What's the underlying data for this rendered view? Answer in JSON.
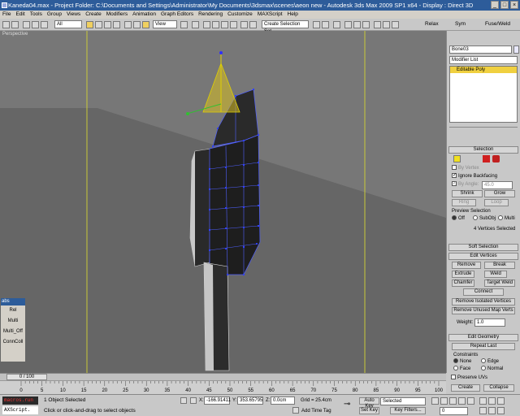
{
  "window": {
    "title": "Kaneda04.max   - Project Folder: C:\\Documents and Settings\\Administrator\\My Documents\\3dsmax\\scenes\\aeon new    - Autodesk 3ds Max  2009 SP1  x64     - Display : Direct 3D",
    "minimize": "_",
    "maximize": "□",
    "close": "×"
  },
  "menu": [
    "File",
    "Edit",
    "Tools",
    "Group",
    "Views",
    "Create",
    "Modifiers",
    "Animation",
    "Graph Editors",
    "Rendering",
    "Customize",
    "MAXScript",
    "Help"
  ],
  "toolbar": {
    "filter": "All",
    "coord": "View",
    "selection_set": "Create Selection Set",
    "relax": "Relax",
    "sym": "Sym",
    "fuse": "Fuse/Weld"
  },
  "viewport": {
    "label": "Perspective"
  },
  "command_panel": {
    "object_name": "Bone03",
    "modifier_list": "Modifier List",
    "stack_item": "Editable Poly",
    "selection": {
      "header": "Selection",
      "by_vertex": "By Vertex",
      "ignore_backfacing": "Ignore Backfacing",
      "by_angle": "By Angle:",
      "angle_value": "45.0",
      "shrink": "Shrink",
      "grow": "Grow",
      "ring": "Ring",
      "loop": "Loop",
      "preview_selection": "Preview Selection",
      "off": "Off",
      "subobj": "SubObj",
      "multi": "Multi",
      "status": "4 Vertices Selected"
    },
    "soft_selection": "Soft Selection",
    "edit_vertices": {
      "header": "Edit Vertices",
      "remove": "Remove",
      "break": "Break",
      "extrude": "Extrude",
      "weld": "Weld",
      "chamfer": "Chamfer",
      "target_weld": "Target Weld",
      "connect": "Connect",
      "remove_isolated": "Remove Isolated Vertices",
      "remove_unused": "Remove Unused Map Verts",
      "weight_label": "Weight:",
      "weight_value": "1.0"
    },
    "edit_geometry": {
      "header": "Edit Geometry",
      "repeat_last": "Repeat Last",
      "constraints": "Constraints",
      "none": "None",
      "edge": "Edge",
      "face": "Face",
      "normal": "Normal",
      "preserve_uvs": "Preserve UVs",
      "create": "Create",
      "collapse": "Collapse"
    }
  },
  "float_panel": {
    "title": "abs",
    "items": [
      "Rel",
      "Multi",
      "Multi_Off",
      "ConnColl"
    ]
  },
  "timeline": {
    "frame": "0 / 100",
    "ticks": [
      "0",
      "5",
      "10",
      "15",
      "20",
      "25",
      "30",
      "35",
      "40",
      "45",
      "50",
      "55",
      "60",
      "65",
      "70",
      "75",
      "80",
      "85",
      "90",
      "95",
      "100"
    ]
  },
  "status": {
    "macro1": "macros.run",
    "macro2": "AXScript.",
    "selected": "1 Object Selected",
    "prompt": "Click or click-and-drag to select objects",
    "x_label": "X:",
    "x_value": "-166.91411",
    "y_label": "Y:",
    "y_value": "353.65795",
    "z_label": "Z:",
    "z_value": "0.0cm",
    "grid": "Grid = 25.4cm",
    "add_time_tag": "Add Time Tag",
    "auto_key": "Auto Key",
    "set_key": "Set Key",
    "key_mode": "Selected",
    "key_filters": "Key Filters...",
    "frame_field": "0"
  }
}
